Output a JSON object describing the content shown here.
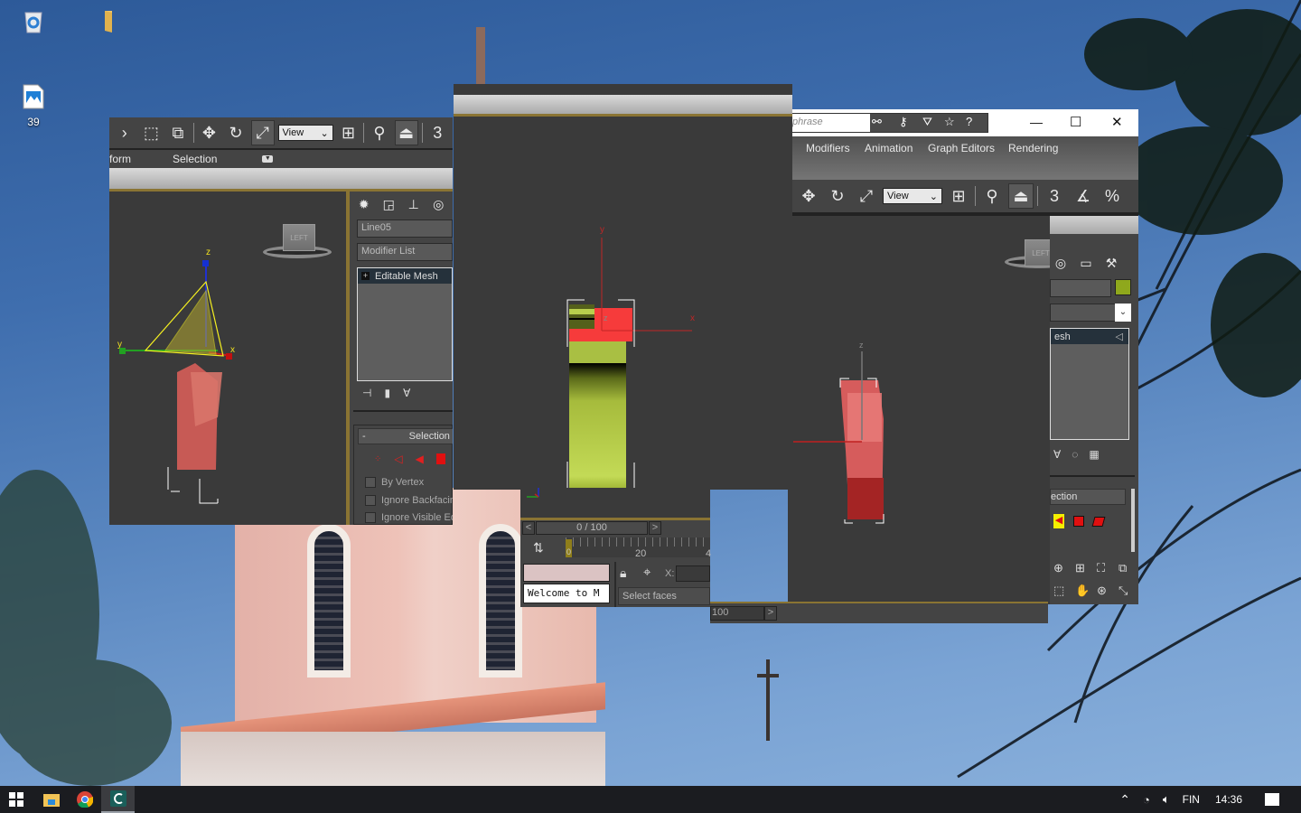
{
  "desktop": {
    "icons": [
      {
        "name": "recycle-bin",
        "label": ""
      },
      {
        "name": "folder",
        "label": ""
      },
      {
        "name": "image-file",
        "label": "39"
      }
    ]
  },
  "left_window": {
    "toolbar": {
      "view_select": "View",
      "snap_label": "3"
    },
    "ribbon_tabs": [
      "form",
      "Selection"
    ],
    "cmd_panel": {
      "object_name": "Line05",
      "modifier_list": "Modifier List",
      "stack_items": [
        "Editable Mesh"
      ],
      "rollout_title": "Selection",
      "rollout_toggle": "-",
      "checkboxes": [
        "By Vertex",
        "Ignore Backfacing",
        "Ignore Visible Edges"
      ]
    },
    "viewport": {
      "viewcube_label": "LEFT",
      "axis_labels": [
        "z",
        "y",
        "x"
      ]
    }
  },
  "middle_window": {
    "viewport": {
      "axis_labels": [
        "y",
        "x",
        "z"
      ]
    },
    "timeline": {
      "frame_display": "0 / 100",
      "prev": "<",
      "next": ">",
      "current_frame": "0",
      "tick_labels": [
        "0",
        "20",
        "4"
      ],
      "progress": 0.0
    },
    "status": {
      "maxscript_output": "Welcome to M",
      "prompt": "Select faces",
      "x_label": "X:"
    }
  },
  "right_window": {
    "search_placeholder": "phrase",
    "window_controls": {
      "minimize": "—",
      "maximize": "☐",
      "close": "✕"
    },
    "menu": [
      "Modifiers",
      "Animation",
      "Graph Editors",
      "Rendering"
    ],
    "toolbar": {
      "view_select": "View",
      "snap_label": "3",
      "percent_label": "%"
    },
    "cmd_panel": {
      "stack_item": "esh",
      "rollout_title": "ection",
      "object_color": "#8fa81c"
    },
    "viewport": {
      "viewcube_label": "LEFT",
      "axis_labels": [
        "z"
      ]
    },
    "timeline": {
      "frame_display": "100",
      "next": ">"
    }
  },
  "taskbar": {
    "apps": [
      "start",
      "file-explorer",
      "chrome",
      "3ds-max"
    ],
    "tray": {
      "language": "FIN",
      "time": "14:36"
    }
  }
}
